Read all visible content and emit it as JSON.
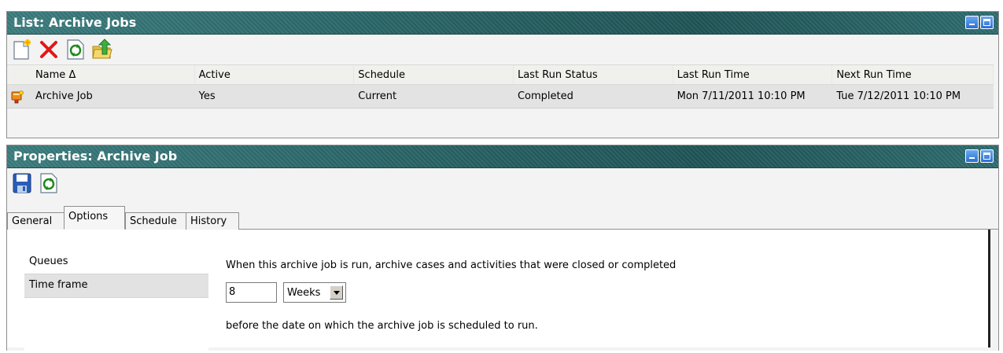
{
  "list_panel": {
    "title": "List: Archive Jobs",
    "toolbar": {
      "new_icon": "new-document-icon",
      "delete_icon": "delete-x-icon",
      "refresh_icon": "refresh-icon",
      "export_icon": "export-folder-icon"
    },
    "columns": [
      "Name Δ",
      "Active",
      "Schedule",
      "Last Run Status",
      "Last Run Time",
      "Next Run Time"
    ],
    "rows": [
      {
        "icon": "archive-job-icon",
        "name": "Archive Job",
        "active": "Yes",
        "schedule": "Current",
        "last_run_status": "Completed",
        "last_run_time": "Mon 7/11/2011 10:10 PM",
        "next_run_time": "Tue 7/12/2011 10:10 PM"
      }
    ]
  },
  "properties_panel": {
    "title": "Properties: Archive Job",
    "toolbar": {
      "save_icon": "save-disk-icon",
      "refresh_icon": "refresh-icon"
    },
    "tabs": [
      "General",
      "Options",
      "Schedule",
      "History"
    ],
    "active_tab": "Options",
    "options_list": [
      "Queues",
      "Time frame"
    ],
    "selected_option": "Time frame",
    "description_before": "When this archive job is run, archive cases and activities that were closed or completed",
    "time_value": "8",
    "time_unit": "Weeks",
    "description_after": "before the date on which the archive job is scheduled to run."
  },
  "colors": {
    "titlebar": "#2f6e70",
    "panel_bg": "#f3f3f3",
    "row_selected": "#e3e3e3"
  }
}
